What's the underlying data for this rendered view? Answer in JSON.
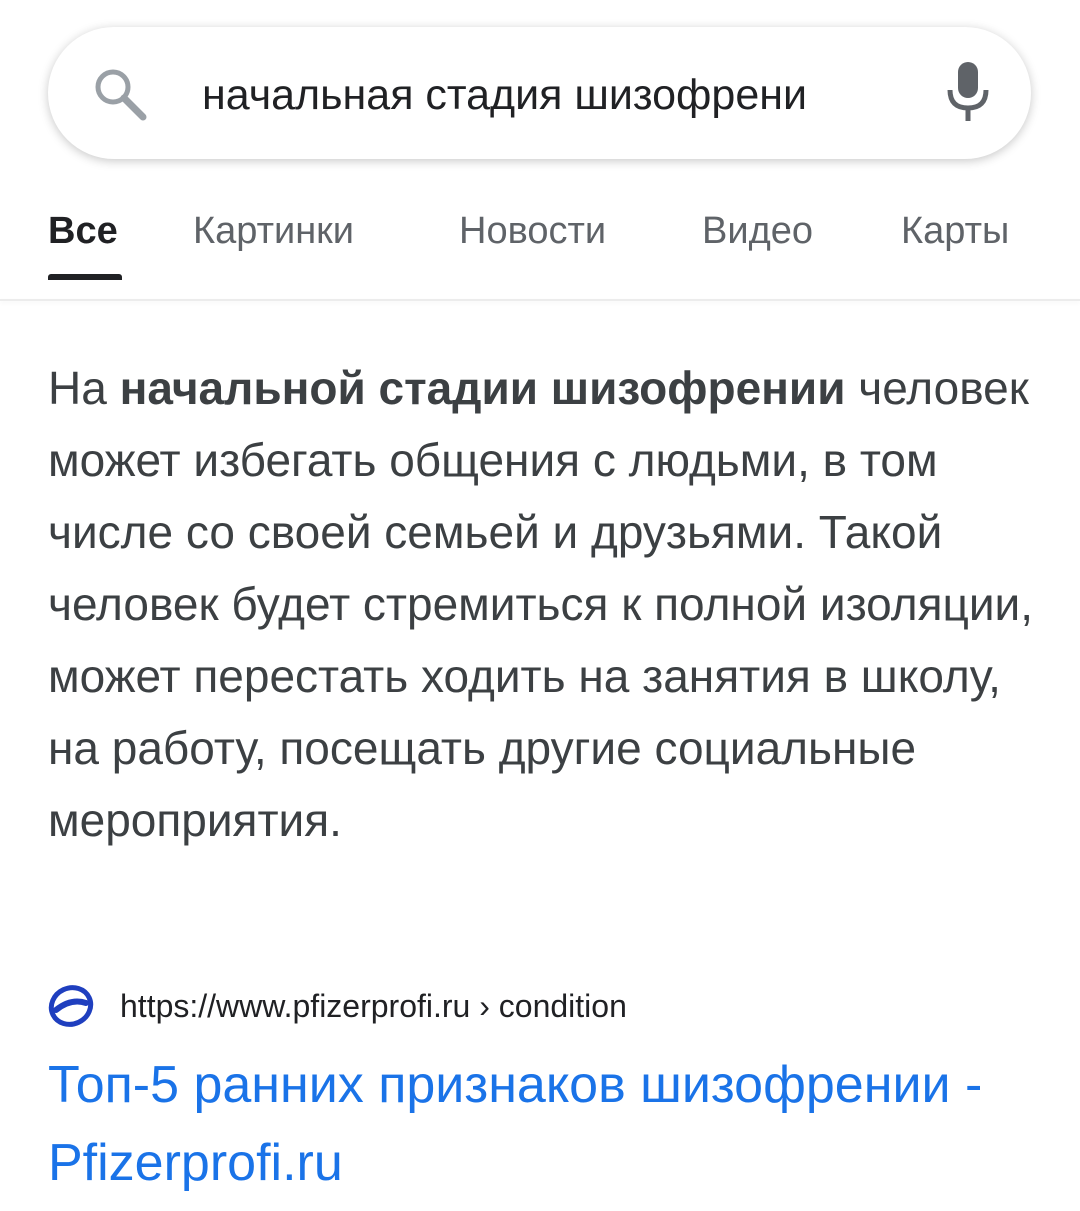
{
  "search": {
    "query": "начальная стадия шизофрени"
  },
  "tabs": [
    {
      "label": "Все",
      "active": true
    },
    {
      "label": "Картинки",
      "active": false
    },
    {
      "label": "Новости",
      "active": false
    },
    {
      "label": "Видео",
      "active": false
    },
    {
      "label": "Карты",
      "active": false
    }
  ],
  "snippet": {
    "prefix": "На ",
    "highlight": "начальной стадии шизофрении",
    "text": " человек может избегать общения с людьми, в том числе со своей семьей и друзьями. Такой человек будет стремиться к полной изоляции, может перестать ходить на занятия в школу, на работу, посещать другие социальные мероприятия."
  },
  "result": {
    "url": "https://www.pfizerprofi.ru › condition",
    "title": "Топ-5 ранних признаков шизофрении - Pfizerprofi.ru",
    "favicon": "pfizer-logo-icon"
  },
  "colors": {
    "link": "#1a73e8",
    "text": "#3c4043",
    "muted": "#5f6368",
    "favicon": "#1f3fbf"
  }
}
